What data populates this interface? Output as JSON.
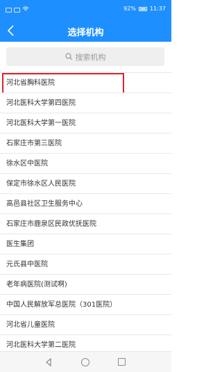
{
  "status": {
    "battery": "92%",
    "time": "11:37"
  },
  "header": {
    "title": "选择机构"
  },
  "search": {
    "placeholder": "搜索机构"
  },
  "list": {
    "items": [
      "河北省胸科医院",
      "河北医科大学第四医院",
      "河北医科大学第一医院",
      "石家庄市第三医院",
      "徐水区中医院",
      "保定市徐水区人民医院",
      "高邑县社区卫生服务中心",
      "石家庄市鹿泉区民政优抚医院",
      "医生集团",
      "元氏县中医院",
      "老年病医院(测试啊)",
      "中国人民解放军总医院（301医院）",
      "河北省儿童医院",
      "河北医科大学第二医院"
    ]
  },
  "colors": {
    "accent": "#1e8fff",
    "highlight": "#e0222e"
  }
}
